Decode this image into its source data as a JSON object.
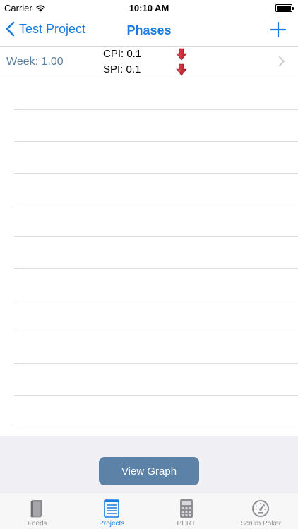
{
  "status_bar": {
    "carrier": "Carrier",
    "time": "10:10 AM"
  },
  "nav": {
    "back_label": "Test Project",
    "title": "Phases"
  },
  "rows": [
    {
      "week": "Week: 1.00",
      "cpi": "CPI: 0.1",
      "spi": "SPI: 0.1",
      "cpi_trend": "down-arrow-icon",
      "spi_trend": "down-arrow-icon"
    }
  ],
  "empty_row_count": 11,
  "view_graph_label": "View Graph",
  "tabs": [
    {
      "label": "Feeds",
      "icon": "book-icon",
      "active": false
    },
    {
      "label": "Projects",
      "icon": "list-icon",
      "active": true
    },
    {
      "label": "PERT",
      "icon": "calculator-icon",
      "active": false
    },
    {
      "label": "Scrum Poker",
      "icon": "gauge-icon",
      "active": false
    }
  ],
  "colors": {
    "accent": "#1a7be0",
    "button": "#5d82a8",
    "trend_down": "#d0202a"
  }
}
